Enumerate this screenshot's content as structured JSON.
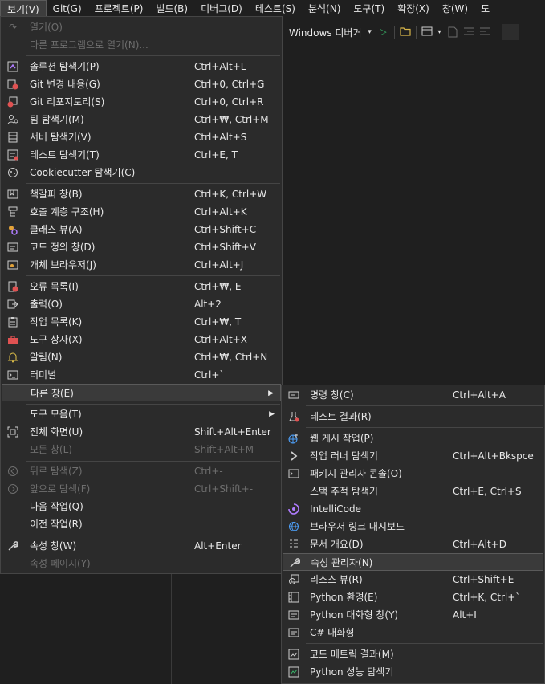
{
  "menubar": {
    "items": [
      {
        "label": "보기(V)",
        "active": true
      },
      {
        "label": "Git(G)"
      },
      {
        "label": "프로젝트(P)"
      },
      {
        "label": "빌드(B)"
      },
      {
        "label": "디버그(D)"
      },
      {
        "label": "테스트(S)"
      },
      {
        "label": "분석(N)"
      },
      {
        "label": "도구(T)"
      },
      {
        "label": "확장(X)"
      },
      {
        "label": "창(W)"
      },
      {
        "label": "도"
      }
    ]
  },
  "toolbar": {
    "debugger_label": "Windows 디버거",
    "dropdown_glyph": "▾",
    "play_glyph": "▷"
  },
  "view_menu": {
    "items": [
      {
        "label": "열기(O)",
        "shortcut": "",
        "icon": "open-icon",
        "disabled": true
      },
      {
        "label": "다른 프로그램으로 열기(N)...",
        "shortcut": "",
        "icon": "",
        "disabled": true
      },
      {
        "label": "솔루션 탐색기(P)",
        "shortcut": "Ctrl+Alt+L",
        "icon": "solution-explorer-icon"
      },
      {
        "label": "Git 변경 내용(G)",
        "shortcut": "Ctrl+0, Ctrl+G",
        "icon": "git-changes-icon"
      },
      {
        "label": "Git 리포지토리(S)",
        "shortcut": "Ctrl+0, Ctrl+R",
        "icon": "git-repository-icon"
      },
      {
        "label": "팀 탐색기(M)",
        "shortcut": "Ctrl+₩, Ctrl+M",
        "icon": "team-explorer-icon"
      },
      {
        "label": "서버 탐색기(V)",
        "shortcut": "Ctrl+Alt+S",
        "icon": "server-explorer-icon"
      },
      {
        "label": "테스트 탐색기(T)",
        "shortcut": "Ctrl+E, T",
        "icon": "test-explorer-icon"
      },
      {
        "label": "Cookiecutter 탐색기(C)",
        "shortcut": "",
        "icon": "cookiecutter-icon"
      },
      {
        "label": "책갈피 창(B)",
        "shortcut": "Ctrl+K, Ctrl+W",
        "icon": "bookmark-window-icon"
      },
      {
        "label": "호출 계층 구조(H)",
        "shortcut": "Ctrl+Alt+K",
        "icon": "call-hierarchy-icon"
      },
      {
        "label": "클래스 뷰(A)",
        "shortcut": "Ctrl+Shift+C",
        "icon": "class-view-icon"
      },
      {
        "label": "코드 정의 창(D)",
        "shortcut": "Ctrl+Shift+V",
        "icon": "code-definition-icon"
      },
      {
        "label": "개체 브라우저(J)",
        "shortcut": "Ctrl+Alt+J",
        "icon": "object-browser-icon"
      },
      {
        "label": "오류 목록(I)",
        "shortcut": "Ctrl+₩, E",
        "icon": "error-list-icon"
      },
      {
        "label": "출력(O)",
        "shortcut": "Alt+2",
        "icon": "output-icon"
      },
      {
        "label": "작업 목록(K)",
        "shortcut": "Ctrl+₩, T",
        "icon": "task-list-icon"
      },
      {
        "label": "도구 상자(X)",
        "shortcut": "Ctrl+Alt+X",
        "icon": "toolbox-icon"
      },
      {
        "label": "알림(N)",
        "shortcut": "Ctrl+₩, Ctrl+N",
        "icon": "bell-icon"
      },
      {
        "label": "터미널",
        "shortcut": "Ctrl+`",
        "icon": "terminal-icon"
      },
      {
        "label": "다른 창(E)",
        "shortcut": "",
        "icon": "",
        "submenu": true,
        "highlighted": true
      },
      {
        "label": "도구 모음(T)",
        "shortcut": "",
        "icon": "",
        "submenu": true
      },
      {
        "label": "전체 화면(U)",
        "shortcut": "Shift+Alt+Enter",
        "icon": "full-screen-icon"
      },
      {
        "label": "모든 창(L)",
        "shortcut": "Shift+Alt+M",
        "icon": "",
        "disabled": true
      },
      {
        "label": "뒤로 탐색(Z)",
        "shortcut": "Ctrl+-",
        "icon": "back-icon",
        "disabled": true
      },
      {
        "label": "앞으로 탐색(F)",
        "shortcut": "Ctrl+Shift+-",
        "icon": "forward-icon",
        "disabled": true
      },
      {
        "label": "다음 작업(Q)",
        "shortcut": "",
        "icon": ""
      },
      {
        "label": "이전 작업(R)",
        "shortcut": "",
        "icon": ""
      },
      {
        "label": "속성 창(W)",
        "shortcut": "Alt+Enter",
        "icon": "wrench-icon"
      },
      {
        "label": "속성 페이지(Y)",
        "shortcut": "",
        "icon": "",
        "disabled": true
      }
    ]
  },
  "other_windows_menu": {
    "items": [
      {
        "label": "명령 창(C)",
        "shortcut": "Ctrl+Alt+A",
        "icon": "command-window-icon"
      },
      {
        "label": "테스트 결과(R)",
        "shortcut": "",
        "icon": "test-results-icon"
      },
      {
        "label": "웹 게시 작업(P)",
        "shortcut": "",
        "icon": "web-publish-icon"
      },
      {
        "label": "작업 러너 탐색기",
        "shortcut": "Ctrl+Alt+Bkspce",
        "icon": "task-runner-icon"
      },
      {
        "label": "패키지 관리자 콘솔(O)",
        "shortcut": "",
        "icon": "package-console-icon"
      },
      {
        "label": "스택 추적 탐색기",
        "shortcut": "Ctrl+E, Ctrl+S",
        "icon": ""
      },
      {
        "label": "IntelliCode",
        "shortcut": "",
        "icon": "intellicode-icon"
      },
      {
        "label": "브라우저 링크 대시보드",
        "shortcut": "",
        "icon": "browser-link-icon"
      },
      {
        "label": "문서 개요(D)",
        "shortcut": "Ctrl+Alt+D",
        "icon": "document-outline-icon"
      },
      {
        "label": "속성 관리자(N)",
        "shortcut": "",
        "icon": "wrench-icon",
        "highlighted": true
      },
      {
        "label": "리소스 뷰(R)",
        "shortcut": "Ctrl+Shift+E",
        "icon": "resource-view-icon"
      },
      {
        "label": "Python 환경(E)",
        "shortcut": "Ctrl+K, Ctrl+`",
        "icon": "python-env-icon"
      },
      {
        "label": "Python 대화형 창(Y)",
        "shortcut": "Alt+I",
        "icon": "python-interactive-icon"
      },
      {
        "label": "C# 대화형",
        "shortcut": "",
        "icon": "csharp-interactive-icon"
      },
      {
        "label": "코드 메트릭 결과(M)",
        "shortcut": "",
        "icon": "code-metrics-icon"
      },
      {
        "label": "Python 성능 탐색기",
        "shortcut": "",
        "icon": "python-performance-icon"
      }
    ]
  }
}
